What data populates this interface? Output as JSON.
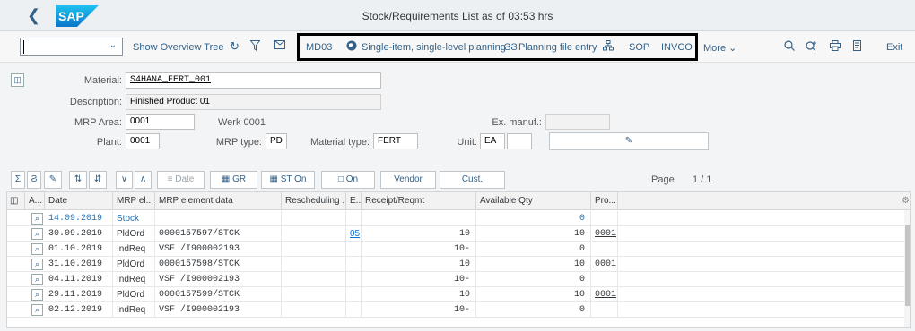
{
  "window": {
    "title": "Stock/Requirements List as of 03:53 hrs"
  },
  "toolbar": {
    "show_overview_tree": "Show Overview Tree",
    "md03": "MD03",
    "single_item": "Single-item, single-level planning",
    "planning_file": "Planning file entry",
    "sop": "SOP",
    "invco": "INVCO",
    "more": "More",
    "exit": "Exit"
  },
  "header": {
    "material_label": "Material:",
    "material_value": "S4HANA_FERT_001",
    "description_label": "Description:",
    "description_value": "Finished Product 01",
    "mrp_area_label": "MRP Area:",
    "mrp_area_value": "0001",
    "werk_text": "Werk 0001",
    "exp_manuf_label": "Ex. manuf.:",
    "plant_label": "Plant:",
    "plant_value": "0001",
    "mrp_type_label": "MRP type:",
    "mrp_type_value": "PD",
    "material_type_label": "Material type:",
    "material_type_value": "FERT",
    "unit_label": "Unit:",
    "unit_value": "EA"
  },
  "gridbar": {
    "date": "Date",
    "gr": "GR",
    "st_on": "ST On",
    "on": "On",
    "vendor": "Vendor",
    "cust": "Cust.",
    "page_label": "Page",
    "page_value": "1 / 1"
  },
  "grid": {
    "columns": [
      "A...",
      "Date",
      "MRP el...",
      "MRP element data",
      "Rescheduling ...",
      "E...",
      "Receipt/Reqmt",
      "Available Qty",
      "Pro..."
    ],
    "rows": [
      {
        "date": "14.09.2019",
        "mrp_el": "Stock",
        "data": "",
        "resched": "",
        "e": "",
        "receipt": "",
        "avail": "0",
        "pro": ""
      },
      {
        "date": "30.09.2019",
        "mrp_el": "PldOrd",
        "data": "0000157597/STCK",
        "resched": "",
        "e": "05",
        "receipt": "10",
        "avail": "10",
        "pro": "0001"
      },
      {
        "date": "01.10.2019",
        "mrp_el": "IndReq",
        "data": "VSF /I900002193",
        "resched": "",
        "e": "",
        "receipt": "10-",
        "avail": "0",
        "pro": ""
      },
      {
        "date": "31.10.2019",
        "mrp_el": "PldOrd",
        "data": "0000157598/STCK",
        "resched": "",
        "e": "",
        "receipt": "10",
        "avail": "10",
        "pro": "0001"
      },
      {
        "date": "04.11.2019",
        "mrp_el": "IndReq",
        "data": "VSF /I900002193",
        "resched": "",
        "e": "",
        "receipt": "10-",
        "avail": "0",
        "pro": ""
      },
      {
        "date": "29.11.2019",
        "mrp_el": "PldOrd",
        "data": "0000157599/STCK",
        "resched": "",
        "e": "",
        "receipt": "10",
        "avail": "10",
        "pro": "0001"
      },
      {
        "date": "02.12.2019",
        "mrp_el": "IndReq",
        "data": "VSF /I900002193",
        "resched": "",
        "e": "",
        "receipt": "10-",
        "avail": "0",
        "pro": ""
      }
    ]
  },
  "colors": {
    "accent": "#346187",
    "brand": "#0a6ed1",
    "highlight_box": "#000000"
  }
}
